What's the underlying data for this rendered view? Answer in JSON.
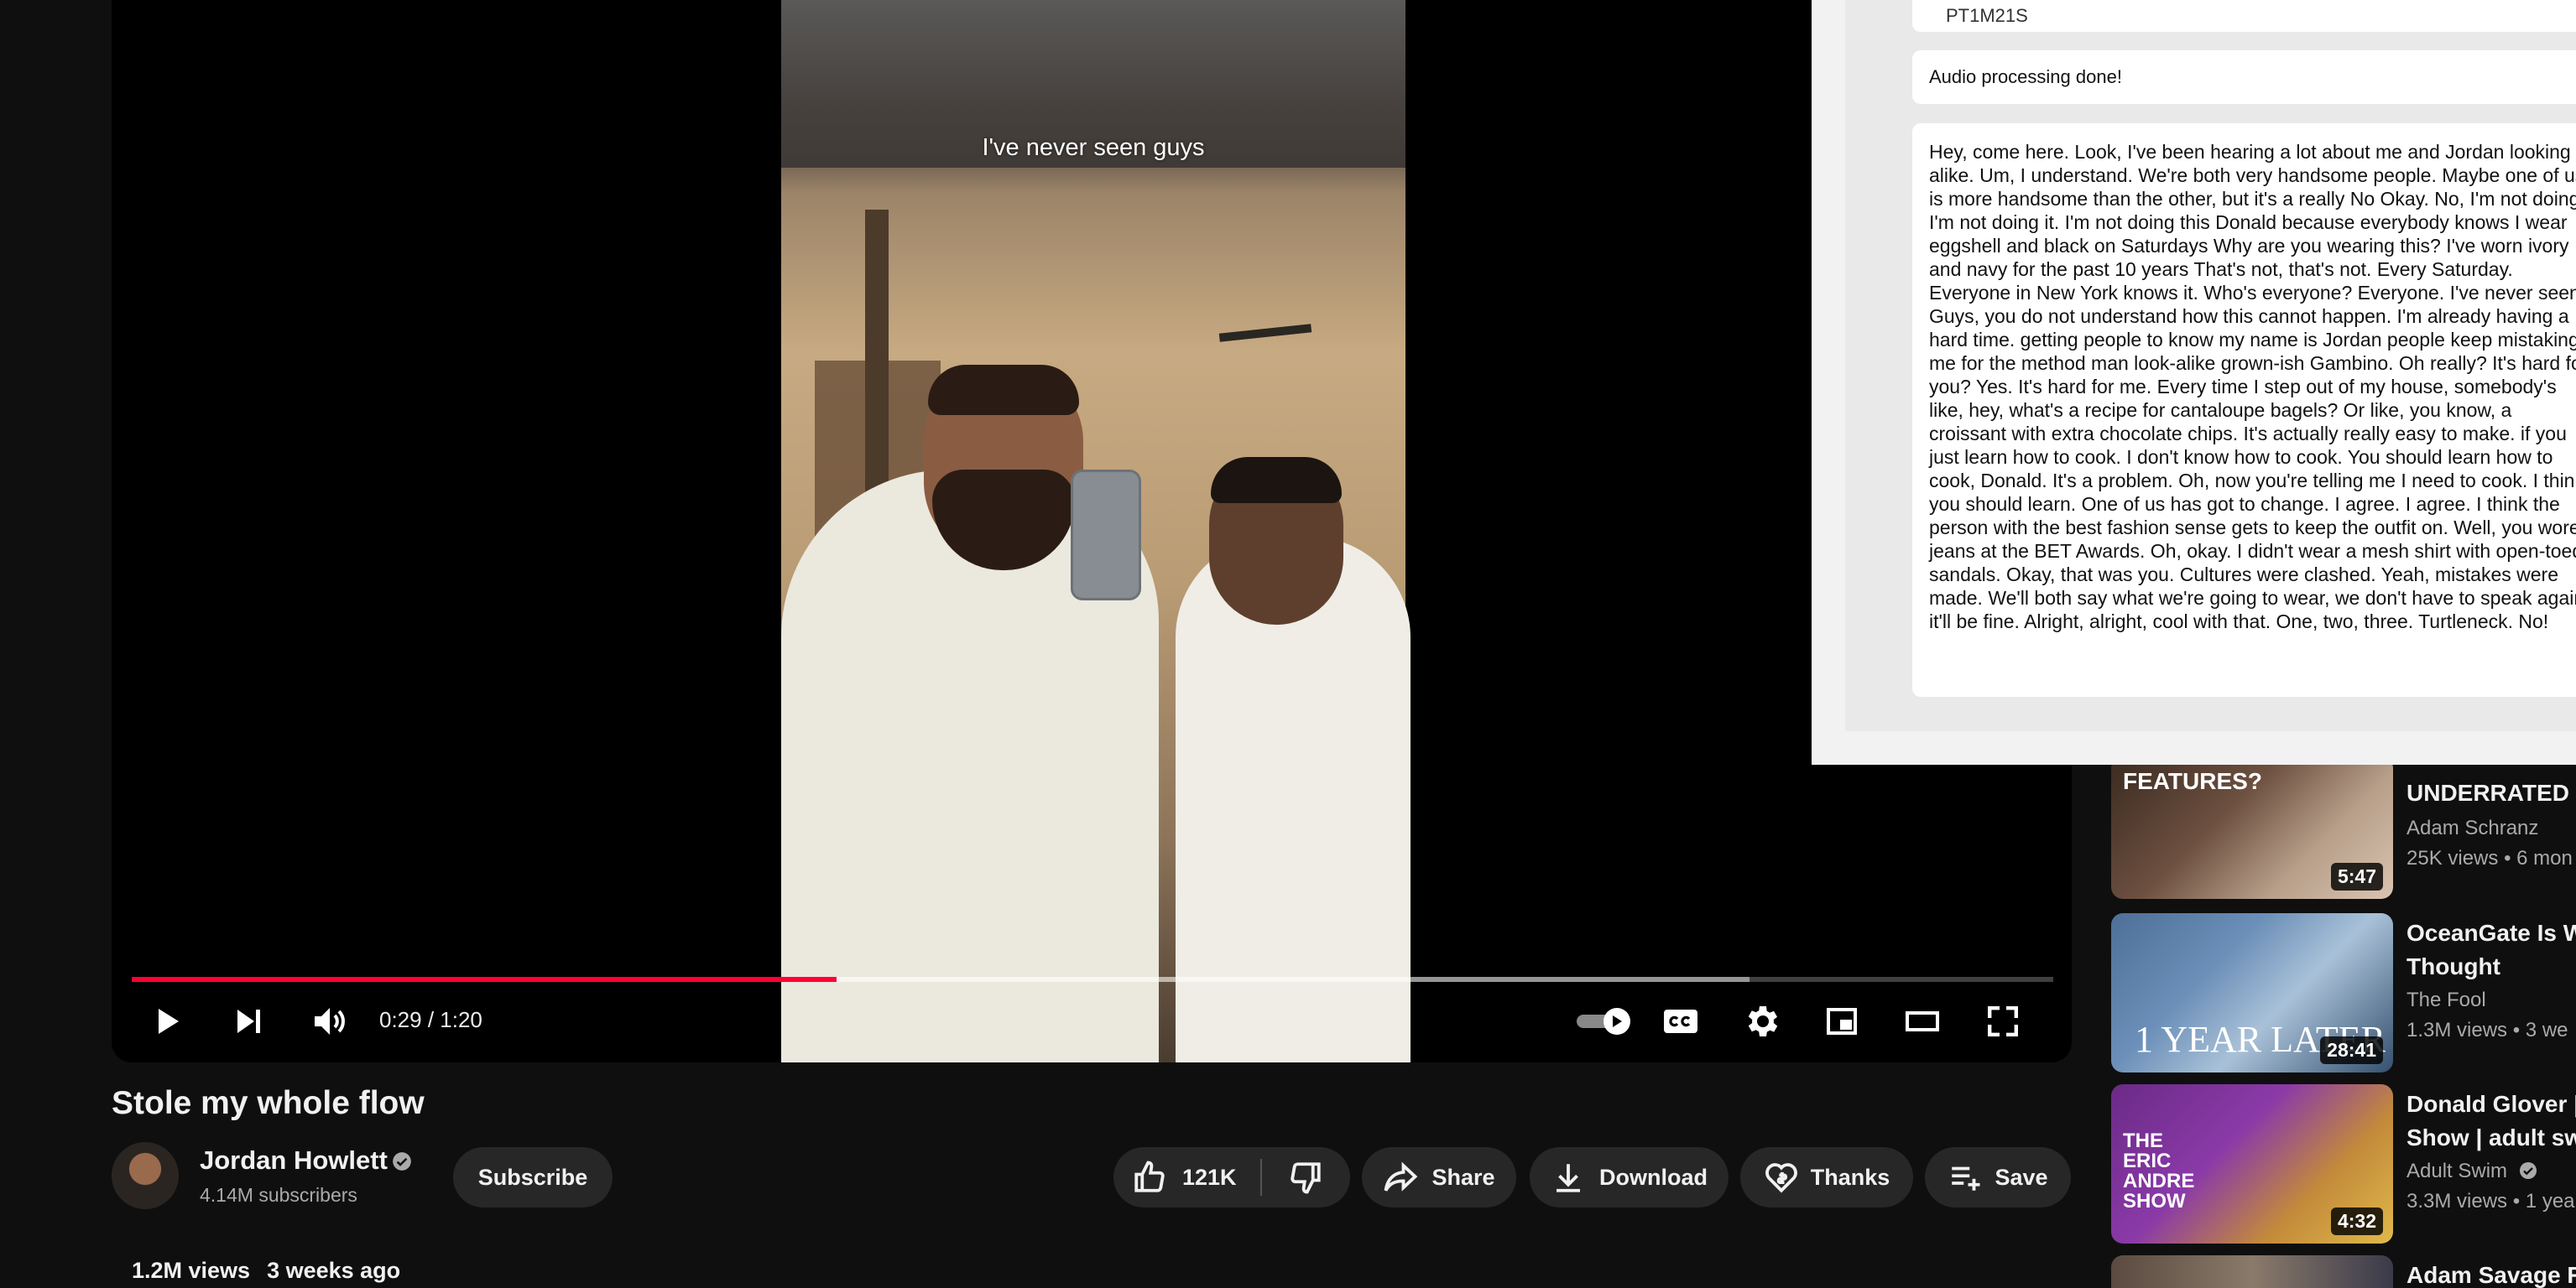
{
  "player": {
    "caption": "I've never seen guys",
    "current_time": "0:29",
    "duration": "1:20",
    "time_display": "0:29 / 1:20",
    "played_fraction": 0.367,
    "buffered_fraction": 0.842,
    "autoplay": true
  },
  "video": {
    "title": "Stole my whole flow",
    "views": "1.2M views",
    "age": "3 weeks ago"
  },
  "channel": {
    "name": "Jordan Howlett",
    "subscribers": "4.14M subscribers",
    "subscribe_label": "Subscribe"
  },
  "actions": {
    "like_count": "121K",
    "share_label": "Share",
    "download_label": "Download",
    "thanks_label": "Thanks",
    "save_label": "Save"
  },
  "panel": {
    "duration_text": "PT1M21S",
    "status": "Audio processing done!",
    "transcript": "Hey, come here. Look, I've been hearing a lot about me and Jordan looking alike. Um, I understand. We're both very handsome people. Maybe one of us is more handsome than the other, but it's a really No Okay. No, I'm not doing I'm not doing it. I'm not doing this Donald because everybody knows I wear eggshell and black on Saturdays Why are you wearing this? I've worn ivory and navy for the past 10 years That's not, that's not. Every Saturday. Everyone in New York knows it. Who's everyone? Everyone. I've never seen. Guys, you do not understand how this cannot happen. I'm already having a hard time. getting people to know my name is Jordan people keep mistaking me for the method man look-alike grown-ish Gambino. Oh really? It's hard for you? Yes. It's hard for me. Every time I step out of my house, somebody's like, hey, what's a recipe for cantaloupe bagels? Or like, you know, a croissant with extra chocolate chips. It's actually really easy to make. if you just learn how to cook. I don't know how to cook. You should learn how to cook, Donald. It's a problem. Oh, now you're telling me I need to cook. I think you should learn. One of us has got to change. I agree. I agree. I think the person with the best fashion sense gets to keep the outfit on. Well, you wore jeans at the BET Awards. Oh, okay. I didn't wear a mesh shirt with open-toed sandals. Okay, that was you. Cultures were clashed. Yeah, mistakes were made. We'll both say what we're going to wear, we don't have to speak again, it'll be fine. Alright, alright, cool with that. One, two, three. Turtleneck. No!"
  },
  "recommendations": [
    {
      "title_line1": "",
      "title_line2": "UNDERRATED",
      "channel": "Adam Schranz",
      "views": "25K views",
      "age": "6 mon",
      "duration": "5:47",
      "thumb_text": "FEATURES?",
      "verified": false
    },
    {
      "title_line1": "OceanGate Is W",
      "title_line2": "Thought",
      "channel": "The Fool",
      "views": "1.3M views",
      "age": "3 we",
      "duration": "28:41",
      "thumb_text": "1 YEAR LATER",
      "verified": false
    },
    {
      "title_line1": "Donald Glover | T",
      "title_line2": "Show | adult sw",
      "channel": "Adult Swim",
      "views": "3.3M views",
      "age": "1 yea",
      "duration": "4:32",
      "thumb_text": "THE ERIC ANDRE SHOW",
      "verified": true
    },
    {
      "title_line1": "Adam Savage Re",
      "title_line2": "",
      "channel": "",
      "views": "",
      "age": "",
      "duration": "",
      "thumb_text": "",
      "verified": false
    }
  ],
  "colors": {
    "background": "#0f0f0f",
    "progress_played": "#ff0033",
    "pill_background": "#272727",
    "panel_background": "#f2f2f2"
  },
  "icons": {
    "play": "play-icon",
    "next": "next-icon",
    "volume": "volume-icon",
    "autoplay": "autoplay-toggle-icon",
    "captions": "captions-icon",
    "settings": "gear-icon",
    "miniplayer": "miniplayer-icon",
    "theater": "theater-icon",
    "fullscreen": "fullscreen-icon"
  }
}
